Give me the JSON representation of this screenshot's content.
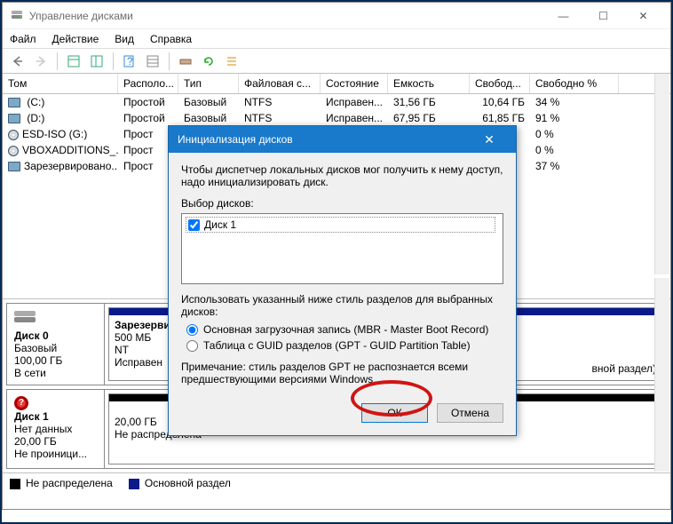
{
  "app": {
    "title": "Управление дисками"
  },
  "menu": {
    "file": "Файл",
    "action": "Действие",
    "view": "Вид",
    "help": "Справка"
  },
  "columns": {
    "c0": "Том",
    "c1": "Располо...",
    "c2": "Тип",
    "c3": "Файловая с...",
    "c4": "Состояние",
    "c5": "Емкость",
    "c6": "Свобод...",
    "c7": "Свободно %"
  },
  "rows": [
    {
      "vol": " (C:)",
      "layout": "Простой",
      "type": "Базовый",
      "fs": "NTFS",
      "status": "Исправен...",
      "cap": "31,56 ГБ",
      "free": "10,64 ГБ",
      "pct": "34 %"
    },
    {
      "vol": " (D:)",
      "layout": "Простой",
      "type": "Базовый",
      "fs": "NTFS",
      "status": "Исправен...",
      "cap": "67,95 ГБ",
      "free": "61,85 ГБ",
      "pct": "91 %"
    },
    {
      "vol": "ESD-ISO (G:)",
      "layout": "Прост",
      "type": "",
      "fs": "",
      "status": "",
      "cap": "",
      "free": "",
      "pct": "0 %",
      "cd": true
    },
    {
      "vol": "VBOXADDITIONS_...",
      "layout": "Прост",
      "type": "",
      "fs": "",
      "status": "",
      "cap": "",
      "free": "",
      "pct": "0 %",
      "cd": true
    },
    {
      "vol": "Зарезервировано...",
      "layout": "Прост",
      "type": "",
      "fs": "",
      "status": "",
      "cap": "",
      "free": "",
      "pct": "37 %"
    }
  ],
  "disk0": {
    "name": "Диск 0",
    "type": "Базовый",
    "size": "100,00 ГБ",
    "state": "В сети",
    "part1_name": "Зарезерви",
    "part1_size": "500 МБ NT",
    "part1_status": "Исправен",
    "part3_tail": "вной раздел)"
  },
  "disk1": {
    "name": "Диск 1",
    "type": "Нет данных",
    "size": "20,00 ГБ",
    "state": "Не проиници...",
    "part_size": "20,00 ГБ",
    "part_status": "Не распределена"
  },
  "legend": {
    "unalloc": "Не распределена",
    "primary": "Основной раздел"
  },
  "dialog": {
    "title": "Инициализация дисков",
    "msg": "Чтобы диспетчер локальных дисков мог получить к нему доступ, надо инициализировать диск.",
    "select_label": "Выбор дисков:",
    "disk_item": "Диск 1",
    "style_label": "Использовать указанный ниже стиль разделов для выбранных дисков:",
    "mbr": "Основная загрузочная запись (MBR - Master Boot Record)",
    "gpt": "Таблица с GUID разделов (GPT - GUID Partition Table)",
    "note": "Примечание: стиль разделов GPT не распознается всеми предшествующими версиями Windows.",
    "ok": "ОК",
    "cancel": "Отмена"
  }
}
